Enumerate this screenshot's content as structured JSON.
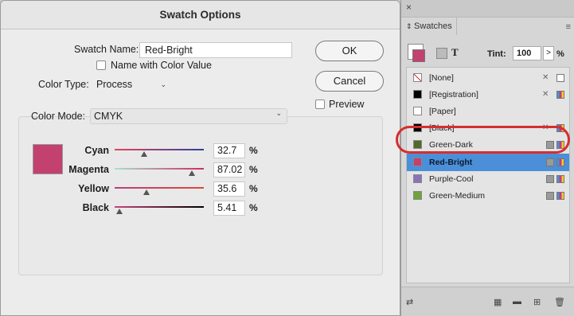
{
  "dialog": {
    "title": "Swatch Options",
    "swatch_name_label": "Swatch Name:",
    "swatch_name_value": "Red-Bright",
    "name_with_color_value_label": "Name with Color Value",
    "color_type_label": "Color Type:",
    "color_type_value": "Process",
    "color_mode_label": "Color Mode:",
    "color_mode_value": "CMYK",
    "ok_label": "OK",
    "cancel_label": "Cancel",
    "preview_label": "Preview",
    "preview_swatch_color": "#c2416f",
    "inks": [
      {
        "label": "Cyan",
        "value": "32.7",
        "fraction": 0.327,
        "gradient": [
          "#e8435f",
          "#2f3f9e"
        ]
      },
      {
        "label": "Magenta",
        "value": "87.02",
        "fraction": 0.8702,
        "gradient": [
          "#a8e2cc",
          "#d4286a"
        ]
      },
      {
        "label": "Yellow",
        "value": "35.6",
        "fraction": 0.356,
        "gradient": [
          "#b8407d",
          "#e0483e"
        ]
      },
      {
        "label": "Black",
        "value": "5.41",
        "fraction": 0.0541,
        "gradient": [
          "#c8447a",
          "#000000"
        ]
      }
    ],
    "percent_sign": "%"
  },
  "panel": {
    "tab_label": "Swatches",
    "tint_label": "Tint:",
    "tint_value": "100",
    "tint_unit": "%",
    "close_glyph": "×",
    "swatches": [
      {
        "name": "[None]",
        "color": "#ffffff",
        "type": "none"
      },
      {
        "name": "[Registration]",
        "color": "#000000",
        "type": "registration"
      },
      {
        "name": "[Paper]",
        "color": "#ffffff",
        "type": "paper"
      },
      {
        "name": "[Black]",
        "color": "#000000",
        "type": "black"
      },
      {
        "name": "Green-Dark",
        "color": "#4f6b2a",
        "type": "process"
      },
      {
        "name": "Red-Bright",
        "color": "#c2416f",
        "type": "process",
        "selected": true
      },
      {
        "name": "Purple-Cool",
        "color": "#8c72b8",
        "type": "process"
      },
      {
        "name": "Green-Medium",
        "color": "#6fa43a",
        "type": "process"
      }
    ],
    "highlight_color": "#d62e2e",
    "selection_color": "#4b8fd8"
  }
}
